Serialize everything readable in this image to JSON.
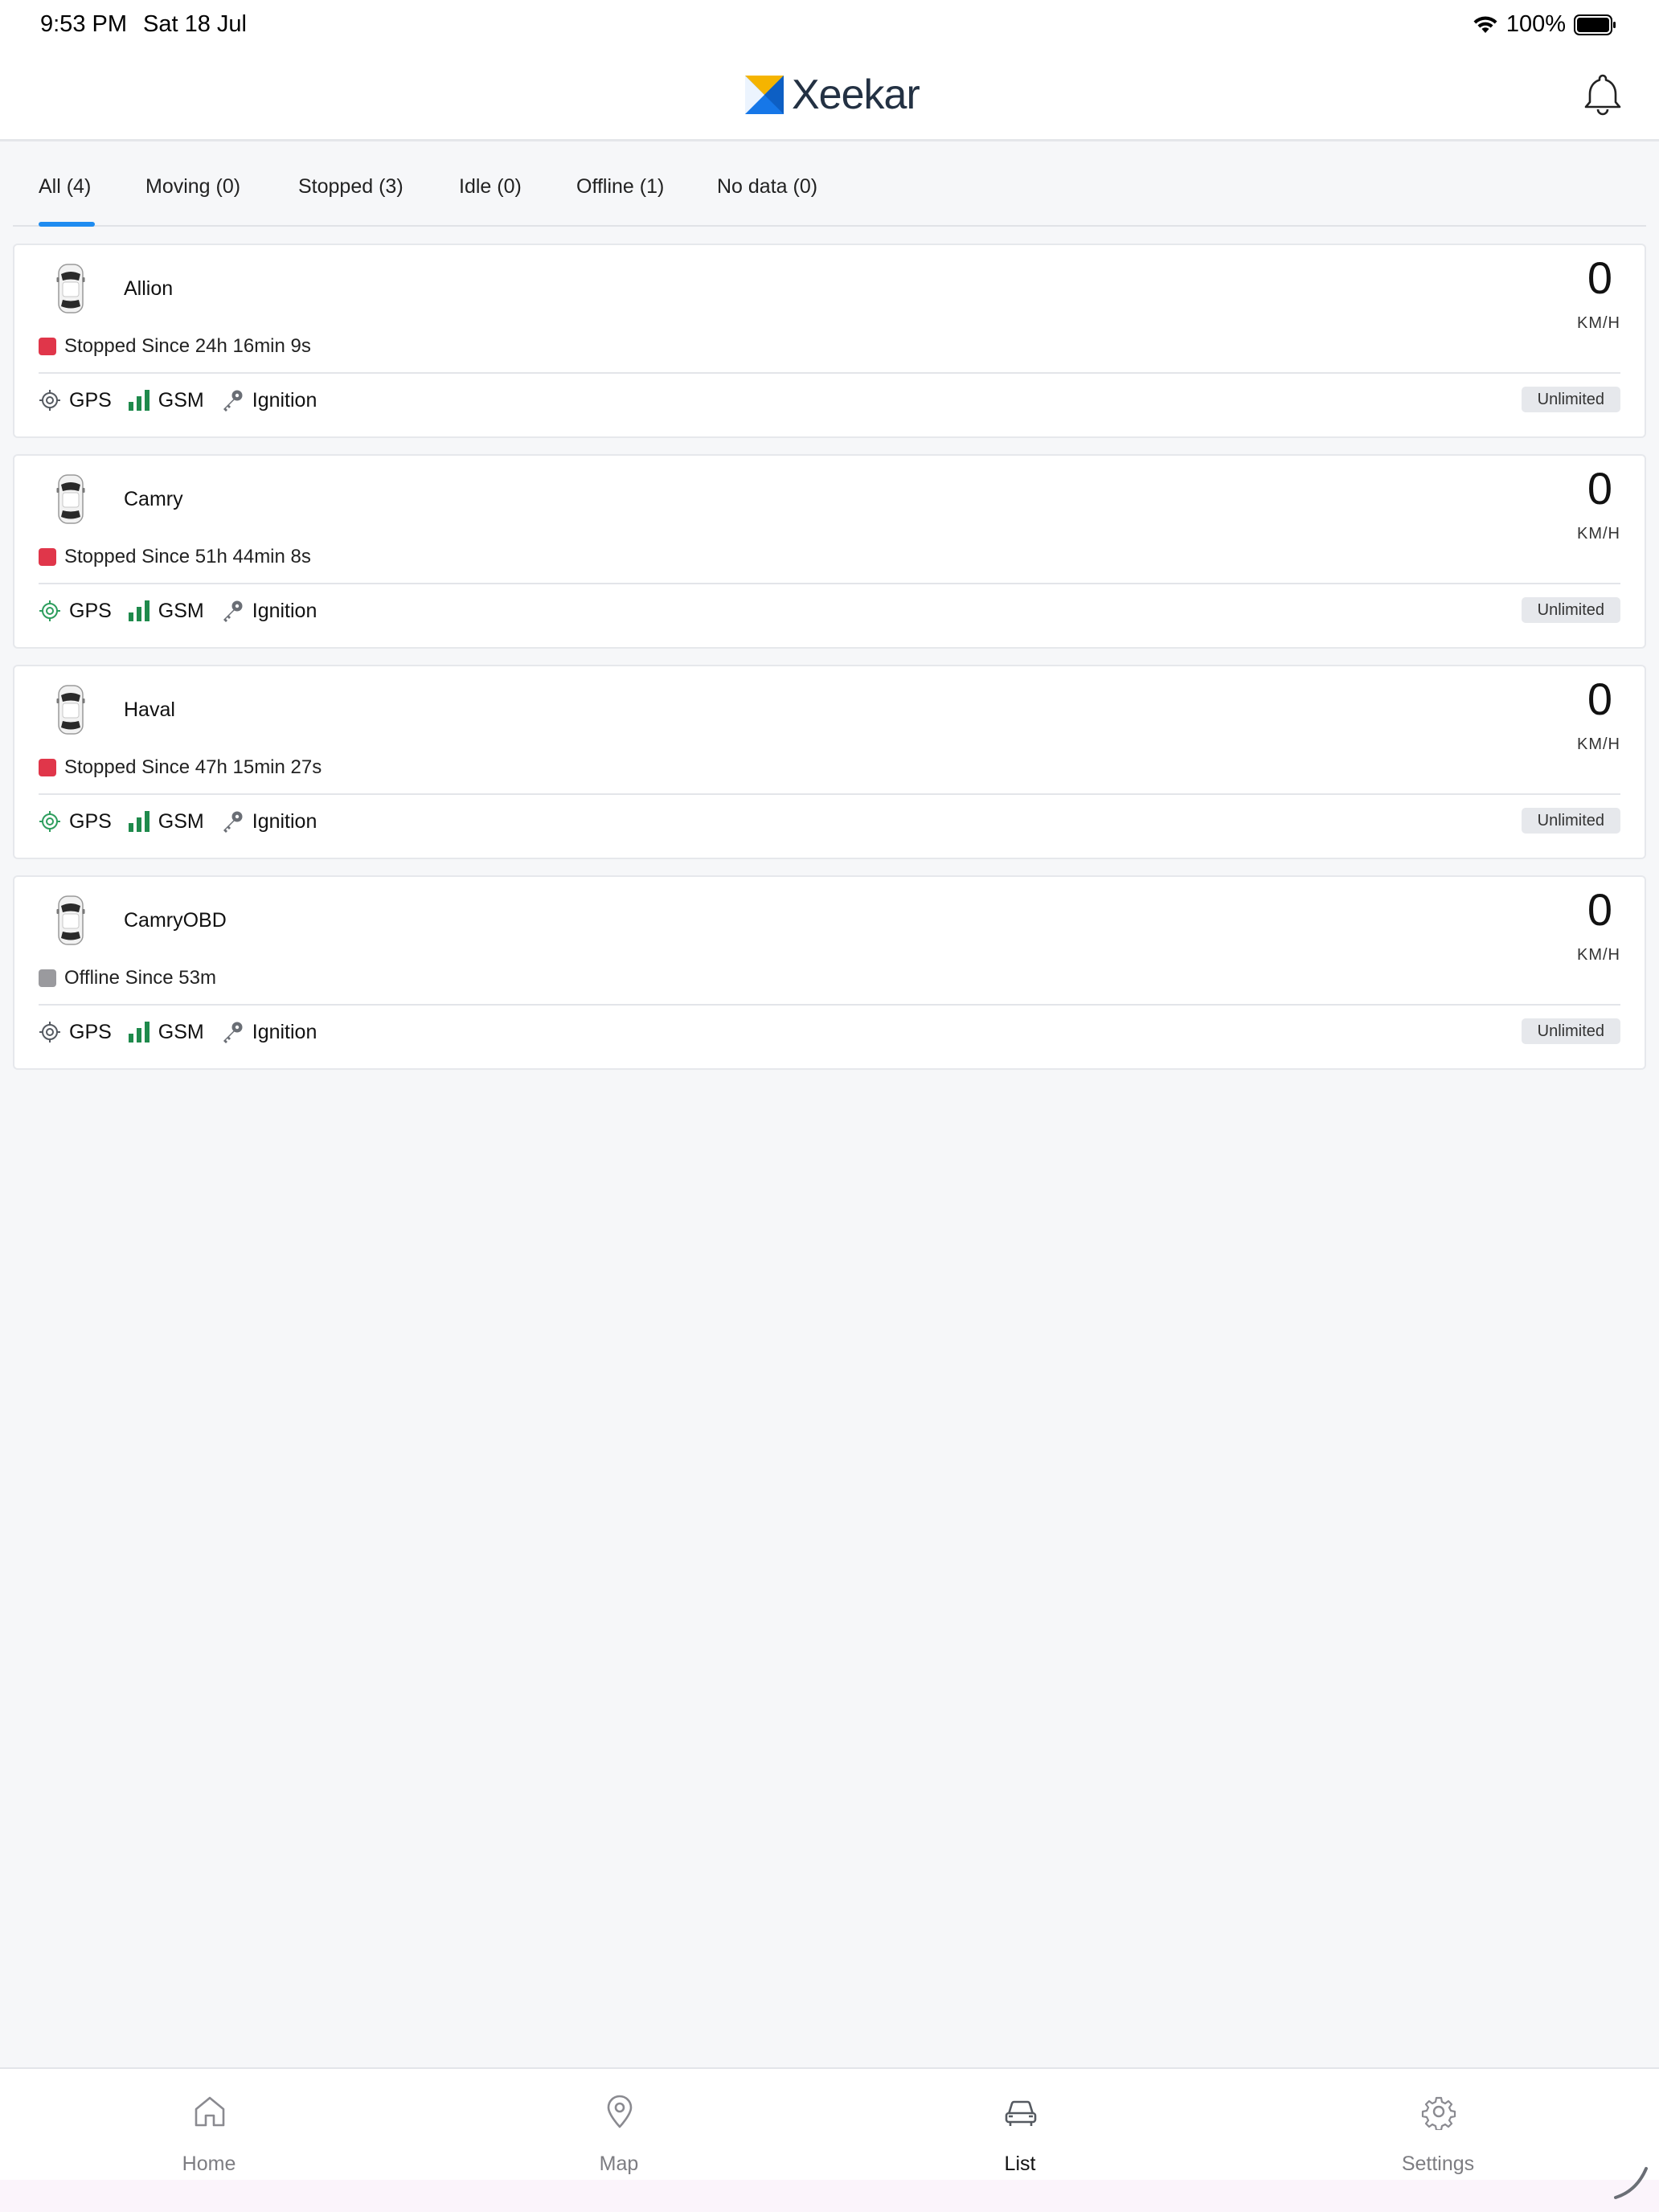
{
  "status_bar": {
    "time": "9:53 PM",
    "date": "Sat 18 Jul",
    "battery": "100%"
  },
  "header": {
    "brand": "Xeekar"
  },
  "tabs": [
    {
      "label": "All (4)",
      "active": true
    },
    {
      "label": "Moving (0)"
    },
    {
      "label": "Stopped (3)"
    },
    {
      "label": "Idle (0)"
    },
    {
      "label": "Offline (1)"
    },
    {
      "label": "No data (0)"
    }
  ],
  "vehicles": [
    {
      "name": "Allion",
      "speed": "0",
      "unit": "KM/H",
      "status": "Stopped Since 24h 16min 9s",
      "status_color": "#e0364a",
      "gps": "GPS",
      "gsm": "GSM",
      "ignition": "Ignition",
      "plan": "Unlimited",
      "gps_color": "#555a61"
    },
    {
      "name": "Camry",
      "speed": "0",
      "unit": "KM/H",
      "status": "Stopped Since 51h 44min 8s",
      "status_color": "#e0364a",
      "gps": "GPS",
      "gsm": "GSM",
      "ignition": "Ignition",
      "plan": "Unlimited",
      "gps_color": "#2e9e5e"
    },
    {
      "name": "Haval",
      "speed": "0",
      "unit": "KM/H",
      "status": "Stopped Since 47h 15min 27s",
      "status_color": "#e0364a",
      "gps": "GPS",
      "gsm": "GSM",
      "ignition": "Ignition",
      "plan": "Unlimited",
      "gps_color": "#2e9e5e"
    },
    {
      "name": "CamryOBD",
      "speed": "0",
      "unit": "KM/H",
      "status": "Offline Since 53m",
      "status_color": "#9a9a9e",
      "gps": "GPS",
      "gsm": "GSM",
      "ignition": "Ignition",
      "plan": "Unlimited",
      "gps_color": "#555a61"
    }
  ],
  "bottom_nav": {
    "home": "Home",
    "map": "Map",
    "list": "List",
    "settings": "Settings",
    "active": "list"
  },
  "colors": {
    "accent": "#1f8cf0",
    "signal": "#1f8a4c"
  }
}
